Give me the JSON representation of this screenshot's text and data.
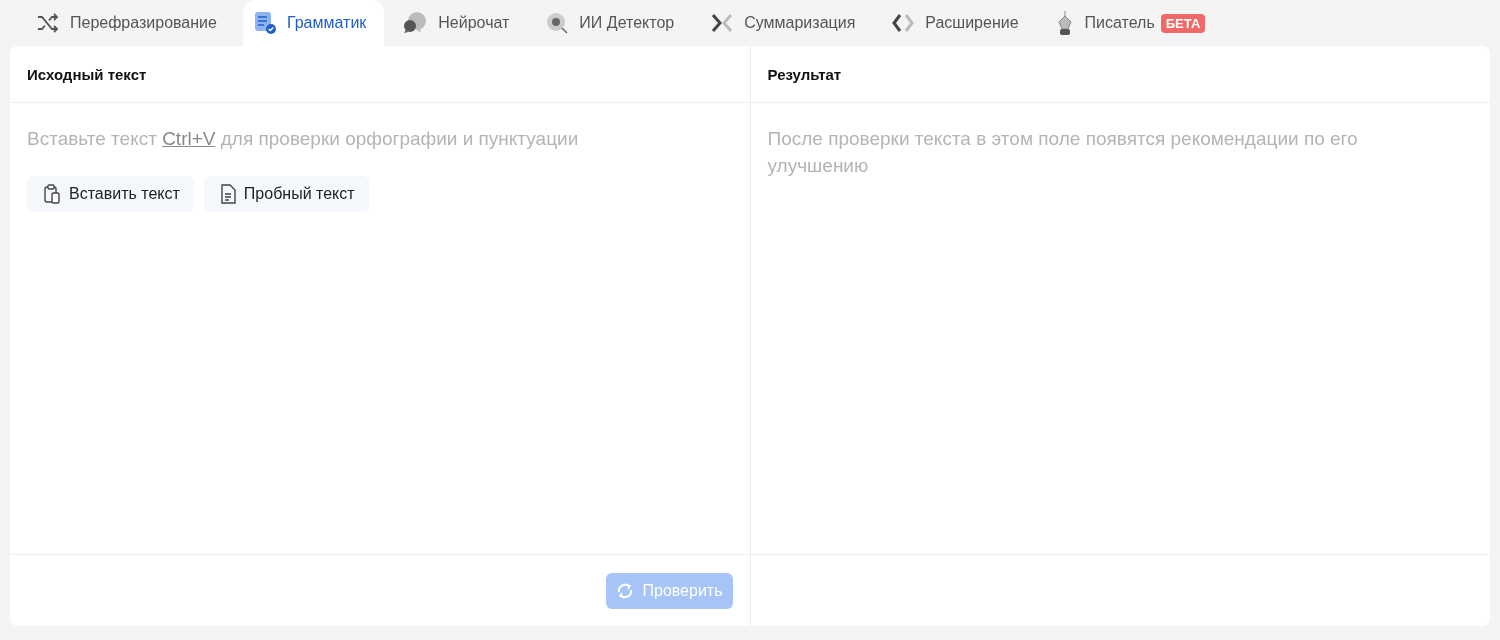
{
  "tabs": [
    {
      "label": "Перефразирование",
      "kind": "shuffle",
      "selected": false
    },
    {
      "label": "Грамматик",
      "kind": "grammar",
      "selected": true
    },
    {
      "label": "Нейрочат",
      "kind": "chat",
      "selected": false
    },
    {
      "label": "ИИ Детектор",
      "kind": "detector",
      "selected": false
    },
    {
      "label": "Суммаризация",
      "kind": "summarize",
      "selected": false
    },
    {
      "label": "Расширение",
      "kind": "expand",
      "selected": false
    },
    {
      "label": "Писатель",
      "kind": "writer",
      "selected": false,
      "badge": "БЕТА"
    }
  ],
  "source": {
    "title": "Исходный текст",
    "placeholder": {
      "before": "Вставьте текст ",
      "shortcut": "Ctrl+V",
      "after": " для проверки орфографии и пунктуации"
    },
    "buttons": [
      {
        "label": "Вставить текст",
        "kind": "paste"
      },
      {
        "label": "Пробный текст",
        "kind": "sample"
      }
    ],
    "check_button": {
      "label": "Проверить",
      "disabled": true
    }
  },
  "result": {
    "title": "Результат",
    "placeholder": "После проверки текста в этом поле появятся рекомендации по его улучшению"
  }
}
